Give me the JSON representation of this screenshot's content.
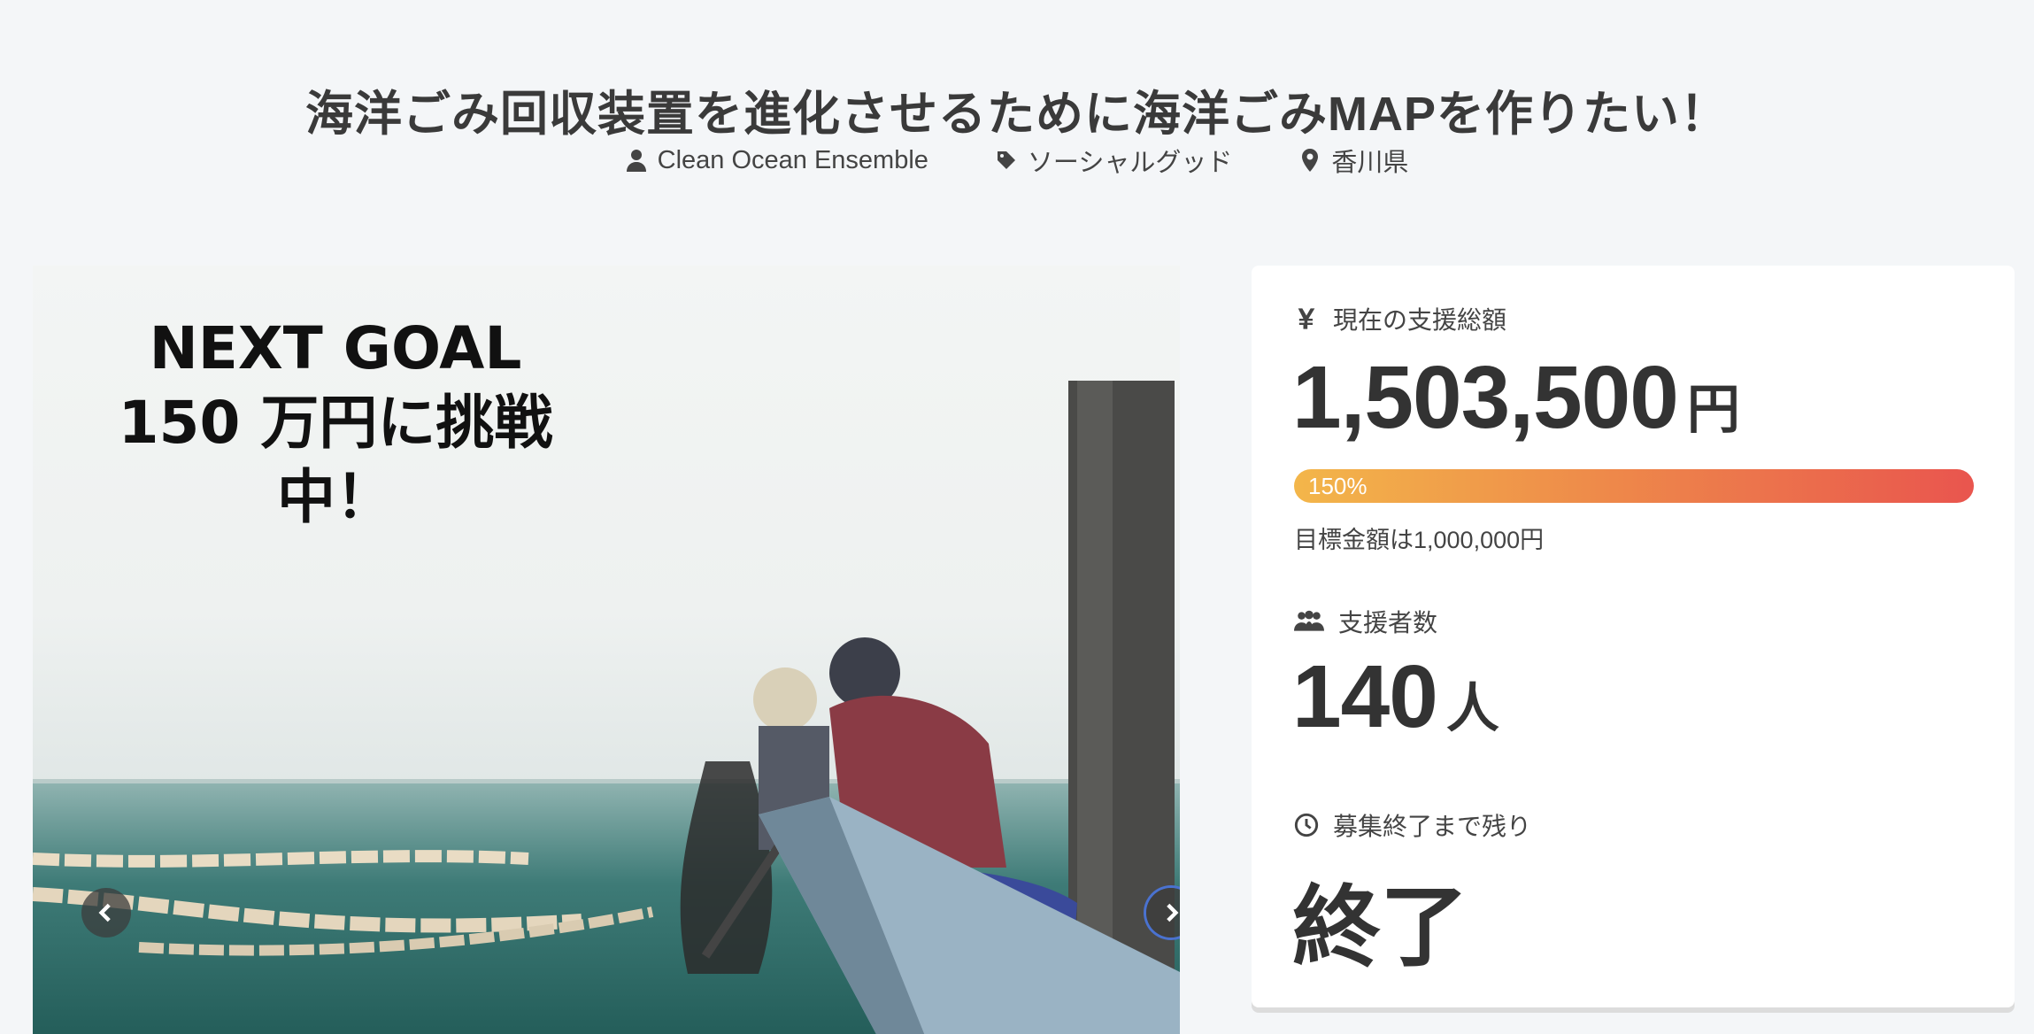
{
  "title": "海洋ごみ回収装置を進化させるために海洋ごみMAPを作りたい！",
  "meta": {
    "owner": "Clean Ocean Ensemble",
    "category": "ソーシャルグッド",
    "location": "香川県"
  },
  "hero": {
    "overlay_line1": "NEXT GOAL",
    "overlay_line2": "150 万円に挑戦中！"
  },
  "stats": {
    "amount_label": "現在の支援総額",
    "amount_value": "1,503,500",
    "amount_unit": "円",
    "progress_percent": 150,
    "progress_label": "150%",
    "goal_text": "目標金額は1,000,000円",
    "supporters_label": "支援者数",
    "supporters_value": "140",
    "supporters_unit": "人",
    "remaining_label": "募集終了まで残り",
    "remaining_value": "終了"
  },
  "icons": {
    "owner": "person-icon",
    "category": "tag-icon",
    "location": "map-pin-icon",
    "amount": "yen-icon",
    "supporters": "people-icon",
    "remaining": "clock-icon"
  },
  "colors": {
    "progress_start": "#f3b64a",
    "progress_end": "#e9554e",
    "nav_focus": "#4a72d0"
  }
}
